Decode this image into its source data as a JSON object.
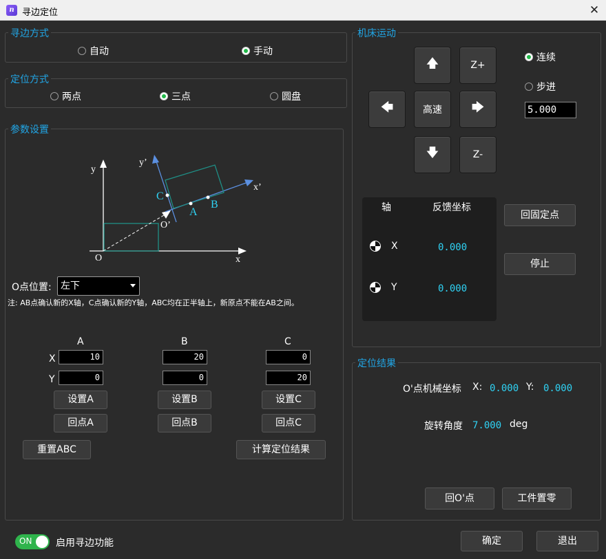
{
  "window": {
    "title": "寻边定位",
    "close_glyph": "✕",
    "icon_text": "n"
  },
  "edge_mode": {
    "title": "寻边方式",
    "options": [
      "自动",
      "手动"
    ],
    "selected": "手动"
  },
  "locate_mode": {
    "title": "定位方式",
    "options": [
      "两点",
      "三点",
      "圆盘"
    ],
    "selected": "三点"
  },
  "params": {
    "title": "参数设置",
    "diagram": {
      "y": "y",
      "x": "x",
      "o": "O",
      "y_prime": "y’",
      "x_prime": "x’",
      "o_prime": "O’",
      "a": "A",
      "b": "B",
      "c": "C"
    },
    "o_position_label": "O点位置:",
    "o_position_value": "左下",
    "note": "注: AB点确认新的X轴，C点确认新的Y轴，ABC均在正半轴上，新原点不能在AB之间。",
    "columns": [
      "A",
      "B",
      "C"
    ],
    "row_x": "X",
    "row_y": "Y",
    "values": {
      "ax": "10",
      "ay": "0",
      "bx": "20",
      "by": "0",
      "cx": "0",
      "cy": "20"
    },
    "set_buttons": [
      "设置A",
      "设置B",
      "设置C"
    ],
    "return_buttons": [
      "回点A",
      "回点B",
      "回点C"
    ],
    "reset_button": "重置ABC",
    "calc_button": "计算定位结果"
  },
  "machine": {
    "title": "机床运动",
    "jog": {
      "up": "🡅",
      "down": "🡇",
      "left": "🡄",
      "right": "🡆",
      "center": "高速",
      "zplus": "Z+",
      "zminus": "Z-"
    },
    "modes": [
      "连续",
      "步进"
    ],
    "selected_mode": "连续",
    "step_value": "5.000",
    "feedback": {
      "header_axis": "轴",
      "header_coord": "反馈坐标",
      "rows": [
        {
          "axis": "X",
          "value": "0.000"
        },
        {
          "axis": "Y",
          "value": "0.000"
        }
      ]
    },
    "home_button": "回固定点",
    "stop_button": "停止"
  },
  "result": {
    "title": "定位结果",
    "mech_label": "O'点机械坐标",
    "x_label": "X:",
    "x_value": "0.000",
    "y_label": "Y:",
    "y_value": "0.000",
    "angle_label": "旋转角度",
    "angle_value": "7.000",
    "angle_unit": "deg",
    "return_o_button": "回O'点",
    "zero_button": "工件置零"
  },
  "footer": {
    "toggle_text": "ON",
    "enable_label": "启用寻边功能",
    "ok_button": "确定",
    "exit_button": "退出"
  },
  "colors": {
    "accent": "#21a6e6",
    "value": "#2fd3f5",
    "toggle": "#2fb44c",
    "radio_on": "#22b94a"
  }
}
